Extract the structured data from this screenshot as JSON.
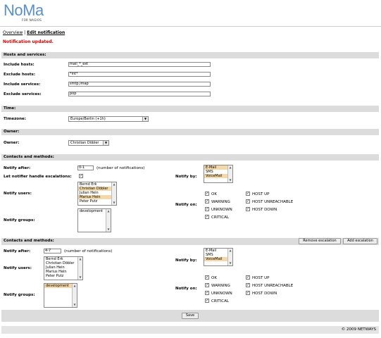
{
  "logo": {
    "word": "NoMa",
    "sub": "FOR NAGIOS"
  },
  "nav": {
    "overview": "Overview",
    "sep": "|",
    "edit": "Edit notification"
  },
  "message": "Notification updated.",
  "hosts_services": {
    "header": "Hosts and services:",
    "include_hosts_label": "Include hosts:",
    "include_hosts_value": "mail_*_ext",
    "exclude_hosts_label": "Exclude hosts:",
    "exclude_hosts_value": "*int*",
    "include_services_label": "Include services:",
    "include_services_value": "smtp,imap",
    "exclude_services_label": "Exclude services:",
    "exclude_services_value": "pop"
  },
  "time": {
    "header": "Time:",
    "timezone_label": "Timezone:",
    "timezone_value": "Europe/Berlin (+1h)"
  },
  "owner": {
    "header": "Owner:",
    "owner_label": "Owner:",
    "owner_value": "Christian Döbler"
  },
  "contacts1": {
    "header": "Contacts and methods:",
    "notify_after_label": "Notify after:",
    "notify_after_value": "0-1",
    "notify_after_unit": "(number of notifications)",
    "escalation_label": "Let notifier handle escalations:",
    "escalation_checked": "✓",
    "notify_users_label": "Notify users:",
    "users": [
      {
        "name": "Bernd Erk",
        "selected": false
      },
      {
        "name": "Christian Döbler",
        "selected": true
      },
      {
        "name": "Julian Hein",
        "selected": false
      },
      {
        "name": "Marius Hein",
        "selected": true
      },
      {
        "name": "Peter Putz",
        "selected": false
      }
    ],
    "notify_groups_label": "Notify groups:",
    "groups": [
      {
        "name": "development",
        "selected": false
      }
    ],
    "notify_by_label": "Notify by:",
    "methods": [
      {
        "name": "E-Mail",
        "selected": true
      },
      {
        "name": "SMS",
        "selected": false
      },
      {
        "name": "VoiceMail",
        "selected": true
      }
    ],
    "notify_on_label": "Notify on:",
    "states": [
      {
        "label": "OK",
        "checked": "✓"
      },
      {
        "label": "HOST UP",
        "checked": "✓"
      },
      {
        "label": "WARNING",
        "checked": "✓"
      },
      {
        "label": "HOST UNREACHABLE",
        "checked": "✓"
      },
      {
        "label": "UNKNOWN",
        "checked": "✓"
      },
      {
        "label": "HOST DOWN",
        "checked": "✓"
      },
      {
        "label": "CRITICAL",
        "checked": "✓"
      }
    ]
  },
  "contacts2": {
    "header": "Contacts and methods:",
    "remove_button": "Remove escalation",
    "add_button": "Add escalation",
    "notify_after_label": "Notify after:",
    "notify_after_value": "4-7",
    "notify_after_unit": "(number of notifications)",
    "notify_users_label": "Notify users:",
    "users": [
      {
        "name": "Bernd Erk",
        "selected": false
      },
      {
        "name": "Christian Döbler",
        "selected": false
      },
      {
        "name": "Julian Hein",
        "selected": false
      },
      {
        "name": "Marius Hein",
        "selected": false
      },
      {
        "name": "Peter Putz",
        "selected": false
      }
    ],
    "notify_groups_label": "Notify groups:",
    "groups": [
      {
        "name": "development",
        "selected": true
      }
    ],
    "notify_by_label": "Notify by:",
    "methods": [
      {
        "name": "E-Mail",
        "selected": false
      },
      {
        "name": "SMS",
        "selected": false
      },
      {
        "name": "VoiceMail",
        "selected": true
      }
    ],
    "notify_on_label": "Notify on:",
    "states": [
      {
        "label": "OK",
        "checked": "✓"
      },
      {
        "label": "HOST UP",
        "checked": "✓"
      },
      {
        "label": "WARNING",
        "checked": "✓"
      },
      {
        "label": "HOST UNREACHABLE",
        "checked": "✓"
      },
      {
        "label": "UNKNOWN",
        "checked": "✓"
      },
      {
        "label": "HOST DOWN",
        "checked": "✓"
      },
      {
        "label": "CRITICAL",
        "checked": "✓"
      }
    ]
  },
  "save_button": "Save",
  "footer": {
    "copyright": "© 2009 NETWAYS"
  }
}
